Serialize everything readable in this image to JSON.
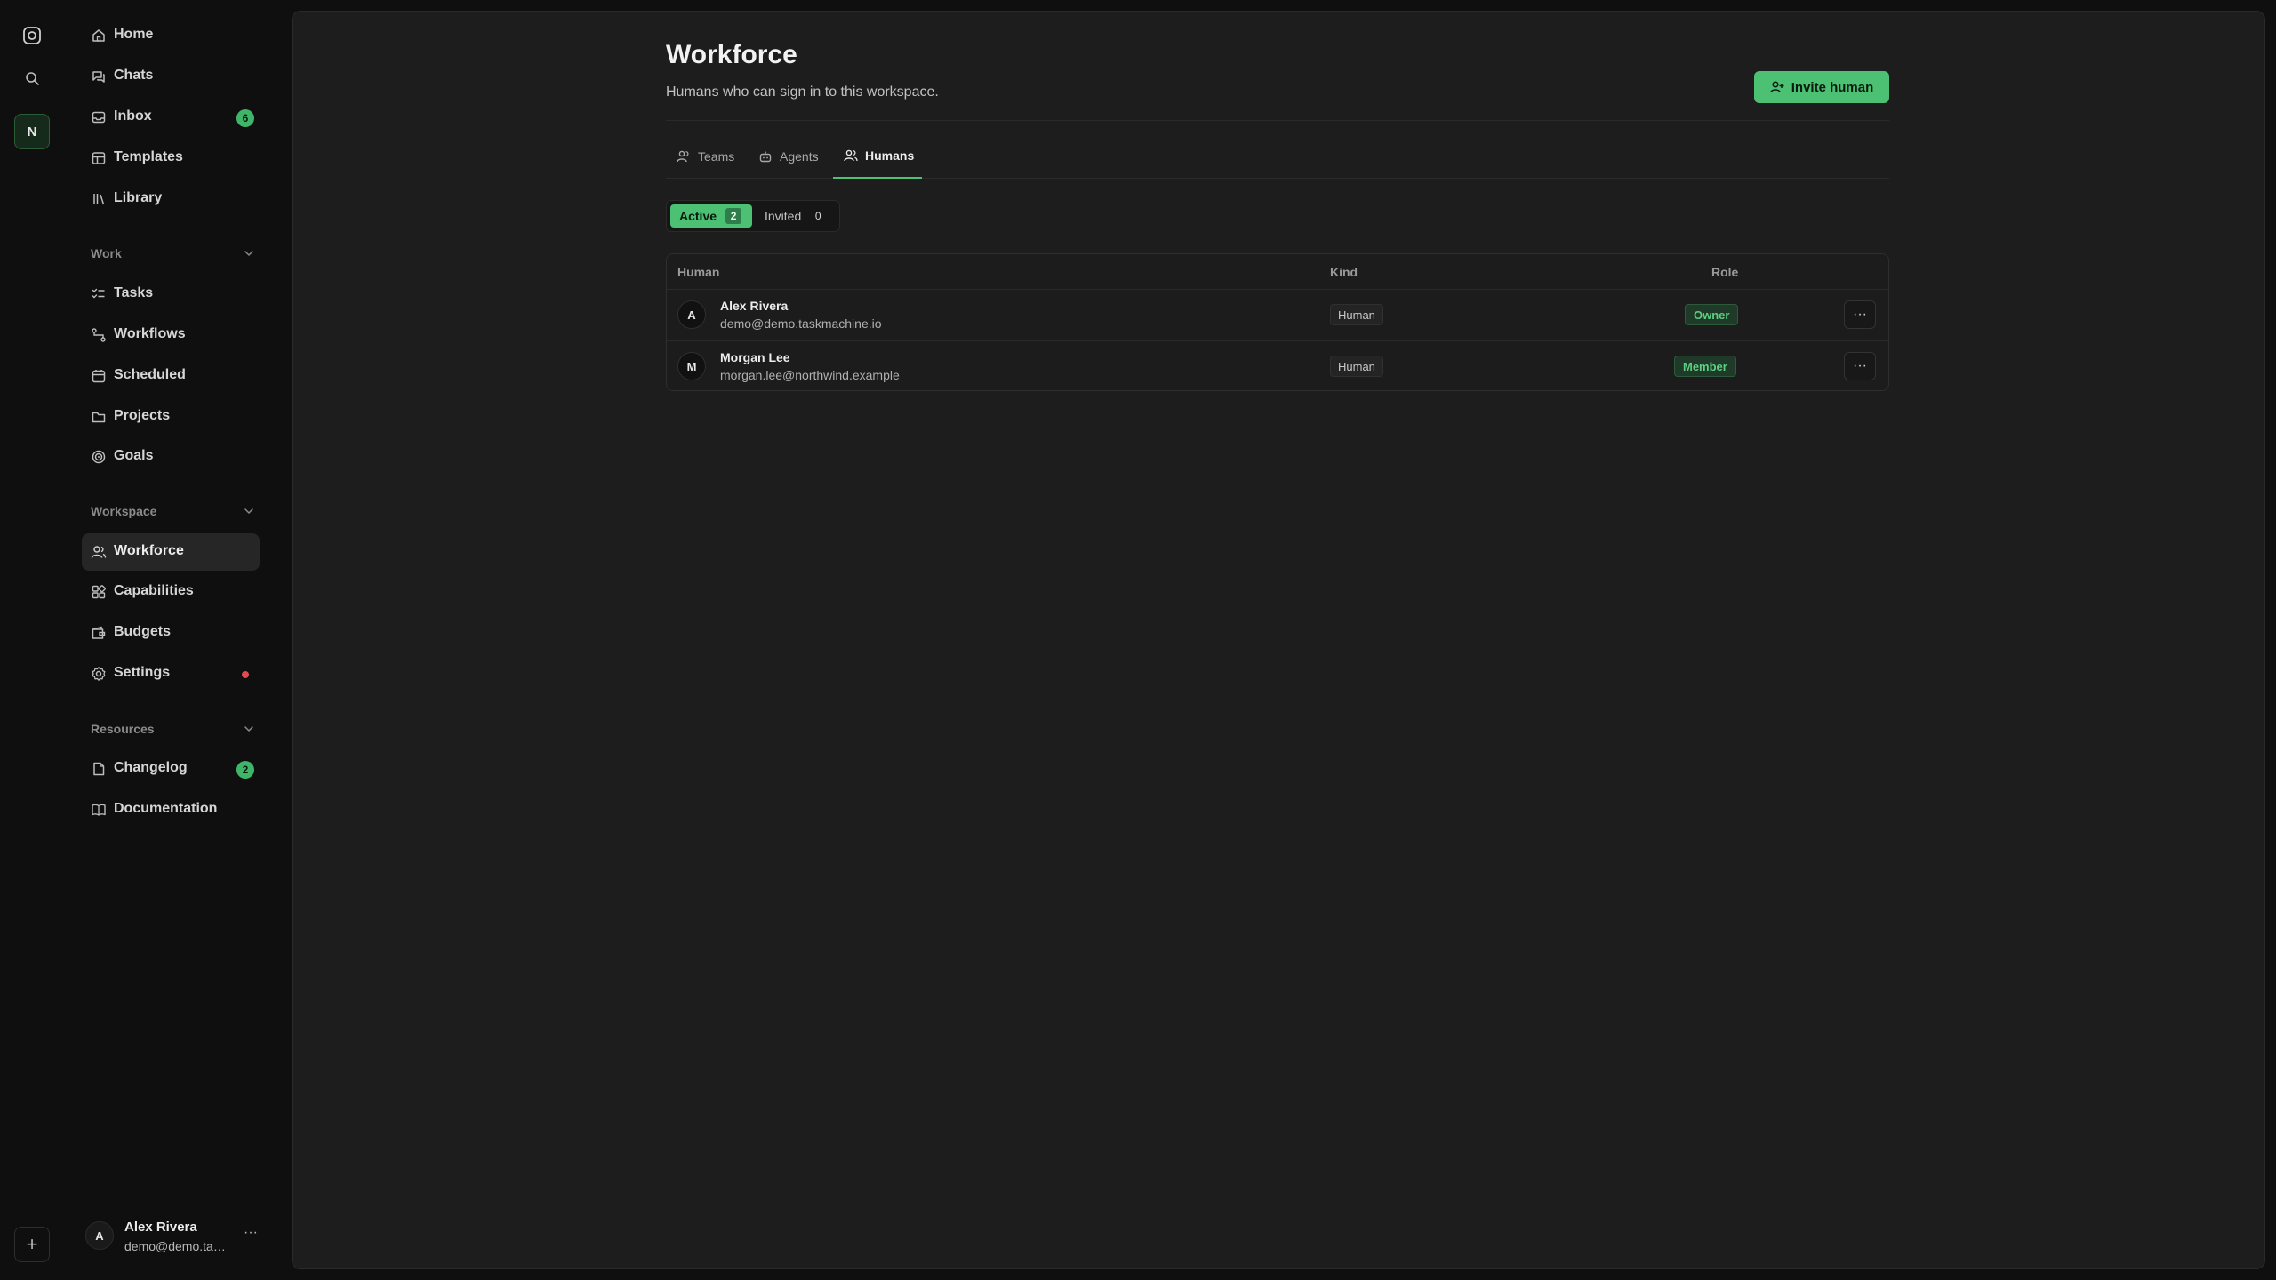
{
  "rail": {
    "workspace_initial": "N",
    "add_label": "+"
  },
  "sidebar": {
    "items": [
      {
        "label": "Home",
        "icon": "home-icon"
      },
      {
        "label": "Chats",
        "icon": "chats-icon"
      },
      {
        "label": "Inbox",
        "icon": "inbox-icon",
        "badge": "6"
      },
      {
        "label": "Templates",
        "icon": "templates-icon"
      },
      {
        "label": "Library",
        "icon": "library-icon"
      }
    ],
    "sections": [
      {
        "label": "Work",
        "items": [
          {
            "label": "Tasks",
            "icon": "tasks-icon"
          },
          {
            "label": "Workflows",
            "icon": "workflows-icon"
          },
          {
            "label": "Scheduled",
            "icon": "scheduled-icon"
          },
          {
            "label": "Projects",
            "icon": "projects-icon"
          },
          {
            "label": "Goals",
            "icon": "goals-icon"
          }
        ]
      },
      {
        "label": "Workspace",
        "items": [
          {
            "label": "Workforce",
            "icon": "workforce-icon",
            "active": true
          },
          {
            "label": "Capabilities",
            "icon": "capabilities-icon"
          },
          {
            "label": "Budgets",
            "icon": "budgets-icon"
          },
          {
            "label": "Settings",
            "icon": "settings-icon",
            "alert_dot": true
          }
        ]
      },
      {
        "label": "Resources",
        "items": [
          {
            "label": "Changelog",
            "icon": "changelog-icon",
            "badge": "2"
          },
          {
            "label": "Documentation",
            "icon": "documentation-icon"
          }
        ]
      }
    ],
    "user": {
      "initial": "A",
      "name": "Alex Rivera",
      "email": "demo@demo.tas...",
      "more": "···"
    }
  },
  "page": {
    "title": "Workforce",
    "subtitle": "Humans who can sign in to this workspace.",
    "invite_label": "Invite human",
    "tabs": [
      {
        "label": "Teams",
        "icon": "teams-icon"
      },
      {
        "label": "Agents",
        "icon": "agents-icon"
      },
      {
        "label": "Humans",
        "icon": "humans-icon",
        "active": true
      }
    ],
    "filter": {
      "active_label": "Active",
      "active_count": "2",
      "invited_label": "Invited",
      "invited_count": "0"
    },
    "table": {
      "columns": [
        "Human",
        "Kind",
        "Role"
      ],
      "rows": [
        {
          "initial": "A",
          "name": "Alex Rivera",
          "email": "demo@demo.taskmachine.io",
          "kind": "Human",
          "role": "Owner",
          "more": "···"
        },
        {
          "initial": "M",
          "name": "Morgan Lee",
          "email": "morgan.lee@northwind.example",
          "kind": "Human",
          "role": "Member",
          "more": "···"
        }
      ]
    }
  },
  "colors": {
    "accent": "#4cc073",
    "background": "#0f0f0f",
    "panel": "#1d1d1d",
    "alert": "#e5484d"
  }
}
